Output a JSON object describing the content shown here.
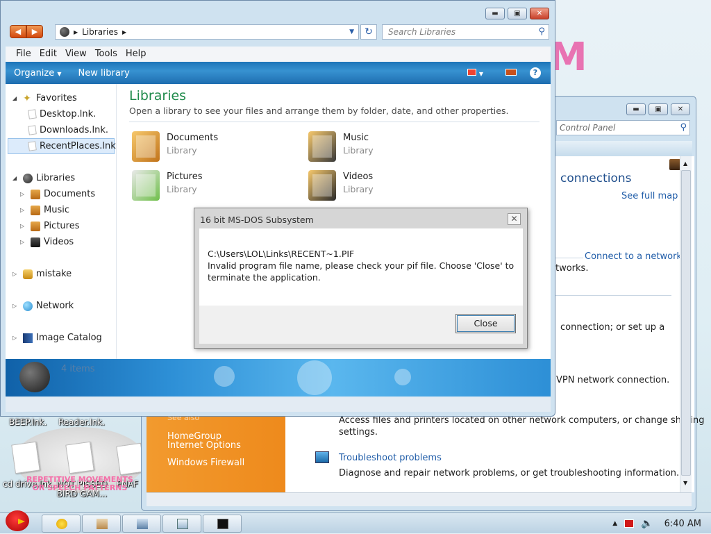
{
  "desktop": {
    "logo_fragment": "M",
    "icons": [
      {
        "label": "BEEP.lnk."
      },
      {
        "label": "Reader.lnk."
      },
      {
        "label": "cd drive.lnk."
      },
      {
        "label": "NOT PISSED BIRD GAM..."
      },
      {
        "label": "FNAF"
      }
    ],
    "wallpaper_text": "REPETITIVE MOVEMENTS OR SPEECH PATTERNS"
  },
  "control_panel": {
    "search_placeholder": "Control Panel",
    "heading": "connections",
    "see_full_map": "See full map",
    "connect_to_network": "Connect to a network",
    "networks_fragment": "tworks.",
    "setup_fragment": "connection; or set up a",
    "vpn_fragment": "VPN network connection.",
    "sharing_text_1": "Access files and printers located on other network computers, or change sharing",
    "sharing_text_2": "settings.",
    "troubleshoot_link": "Troubleshoot problems",
    "troubleshoot_desc": "Diagnose and repair network problems, or get troubleshooting information.",
    "see_also_header": "See also",
    "see_also": [
      "HomeGroup",
      "Internet Options",
      "Windows Firewall"
    ]
  },
  "explorer": {
    "address": "Libraries",
    "search_placeholder": "Search Libraries",
    "menu": [
      "File",
      "Edit",
      "View",
      "Tools",
      "Help"
    ],
    "commands": {
      "organize": "Organize",
      "new_library": "New library"
    },
    "nav": {
      "favorites": "Favorites",
      "fav_items": [
        "Desktop.lnk.",
        "Downloads.lnk.",
        "RecentPlaces.lnk."
      ],
      "libraries": "Libraries",
      "lib_items": [
        "Documents",
        "Music",
        "Pictures",
        "Videos"
      ],
      "mistake": "mistake",
      "network": "Network",
      "image_catalog": "Image Catalog"
    },
    "title": "Libraries",
    "subtitle": "Open a library to see your files and arrange them by folder, date, and other properties.",
    "libraries": [
      {
        "name": "Documents",
        "type": "Library"
      },
      {
        "name": "Music",
        "type": "Library"
      },
      {
        "name": "Pictures",
        "type": "Library"
      },
      {
        "name": "Videos",
        "type": "Library"
      }
    ],
    "item_count": "4 items"
  },
  "dialog": {
    "title": "16 bit MS-DOS Subsystem",
    "path": "C:\\Users\\LOL\\Links\\RECENT~1.PIF",
    "message": "Invalid program file name, please check your pif file. Choose 'Close' to terminate the application.",
    "close_label": "Close"
  },
  "taskbar": {
    "time": "6:40 AM"
  },
  "colors": {
    "explorer_title": "#1e8a4a",
    "link": "#1f5ca8",
    "control_panel_sidebar": "#f29a2e",
    "command_bar": "#1e6db0"
  }
}
